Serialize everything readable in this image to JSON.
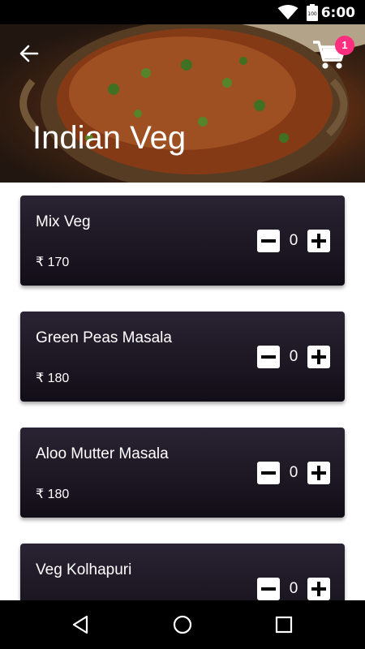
{
  "status_bar": {
    "time": "6:00",
    "battery_level": "100"
  },
  "header": {
    "title": "Indian Veg",
    "cart_count": "1"
  },
  "items": [
    {
      "name": "Mix Veg",
      "price": "₹ 170",
      "quantity": "0"
    },
    {
      "name": "Green Peas Masala",
      "price": "₹ 180",
      "quantity": "0"
    },
    {
      "name": "Aloo Mutter Masala",
      "price": "₹ 180",
      "quantity": "0"
    },
    {
      "name": "Veg Kolhapuri",
      "price": "",
      "quantity": "0"
    }
  ],
  "icons": {
    "back": "arrow-left-icon",
    "cart": "shopping-cart-icon",
    "minus": "minus-icon",
    "plus": "plus-icon",
    "nav_back": "triangle-back-icon",
    "nav_home": "circle-home-icon",
    "nav_recents": "square-recents-icon"
  },
  "colors": {
    "badge": "#ff2e7e",
    "card_top": "#2a2333",
    "card_bottom": "#120e17"
  }
}
